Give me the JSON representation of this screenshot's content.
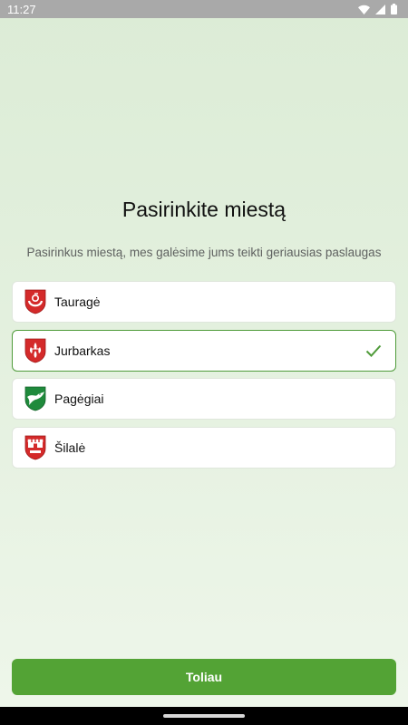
{
  "status_bar": {
    "time": "11:27",
    "icons": [
      "wifi-icon",
      "cellular-signal-icon",
      "battery-icon"
    ]
  },
  "title": "Pasirinkite miestą",
  "subtitle": "Pasirinkus miestą, mes galėsime jums teikti geriausias paslaugas",
  "cities": [
    {
      "name": "Tauragė",
      "icon": "taurage-crest-icon",
      "selected": false
    },
    {
      "name": "Jurbarkas",
      "icon": "jurbarkas-crest-icon",
      "selected": true
    },
    {
      "name": "Pagėgiai",
      "icon": "pagegiai-crest-icon",
      "selected": false
    },
    {
      "name": "Šilalė",
      "icon": "silale-crest-icon",
      "selected": false
    }
  ],
  "next_button": {
    "label": "Toliau"
  },
  "colors": {
    "accent": "#53a335",
    "selected_border": "#4f9b3a",
    "background": "#e3f0de"
  }
}
